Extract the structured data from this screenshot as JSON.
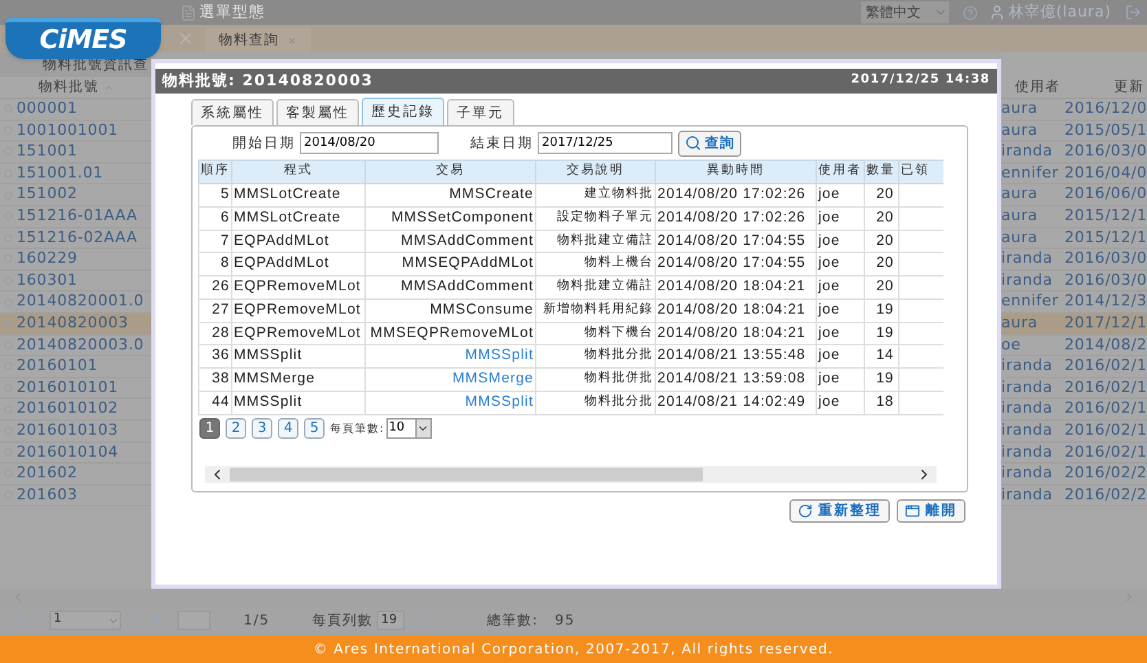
{
  "top_bar": {
    "menu_type": "選單型態",
    "language": "繁體中文",
    "user": "林宰億(laura)"
  },
  "logo": "CiMES",
  "tabs": [
    {
      "label": "物料查詢",
      "selected": true
    }
  ],
  "list_panel": {
    "title": "物料批號資訊查",
    "column": "物料批號",
    "columns_right": [
      "使用者",
      "更新"
    ],
    "rows": [
      {
        "lot": "000001",
        "user": "aura",
        "updated": "2016/12/0",
        "selected": false
      },
      {
        "lot": "1001001001",
        "user": "aura",
        "updated": "2015/05/1",
        "selected": false
      },
      {
        "lot": "151001",
        "user": "iranda",
        "updated": "2016/03/0",
        "selected": false
      },
      {
        "lot": "151001.01",
        "user": "ennifer",
        "updated": "2016/04/0",
        "selected": false
      },
      {
        "lot": "151002",
        "user": "aura",
        "updated": "2016/06/0",
        "selected": false
      },
      {
        "lot": "151216-01AAA",
        "user": "aura",
        "updated": "2015/12/1",
        "selected": false
      },
      {
        "lot": "151216-02AAA",
        "user": "aura",
        "updated": "2015/12/1",
        "selected": false
      },
      {
        "lot": "160229",
        "user": "iranda",
        "updated": "2016/03/0",
        "selected": false
      },
      {
        "lot": "160301",
        "user": "iranda",
        "updated": "2016/03/0",
        "selected": false
      },
      {
        "lot": "20140820001.0",
        "user": "ennifer",
        "updated": "2014/12/3",
        "selected": false
      },
      {
        "lot": "20140820003",
        "user": "aura",
        "updated": "2017/12/1",
        "selected": true
      },
      {
        "lot": "20140820003.0",
        "user": "oe",
        "updated": "2014/08/2",
        "selected": false
      },
      {
        "lot": "20160101",
        "user": "iranda",
        "updated": "2016/02/1",
        "selected": false
      },
      {
        "lot": "2016010101",
        "user": "iranda",
        "updated": "2016/02/1",
        "selected": false
      },
      {
        "lot": "2016010102",
        "user": "iranda",
        "updated": "2016/02/1",
        "selected": false
      },
      {
        "lot": "2016010103",
        "user": "iranda",
        "updated": "2016/02/1",
        "selected": false
      },
      {
        "lot": "2016010104",
        "user": "iranda",
        "updated": "2016/02/1",
        "selected": false
      },
      {
        "lot": "201602",
        "user": "iranda",
        "updated": "2016/02/2",
        "selected": false
      },
      {
        "lot": "201603",
        "user": "iranda",
        "updated": "2016/02/2",
        "selected": false
      }
    ]
  },
  "pager": {
    "page": "1",
    "page_count": "1/5",
    "rows_per_page_label": "每頁列數",
    "rows_per_page": "19",
    "total_label": "總筆數:",
    "total": "95"
  },
  "footer": "© Ares International Corporation, 2007-2017, All rights reserved.",
  "dialog": {
    "title": "物料批號: 20140820003",
    "time": "2017/12/25 14:38",
    "tabs": [
      {
        "label": "系統屬性",
        "selected": false
      },
      {
        "label": "客製屬性",
        "selected": false
      },
      {
        "label": "歷史記錄",
        "selected": true
      },
      {
        "label": "子單元",
        "selected": false
      }
    ],
    "start_label": "開始日期",
    "start_date": "2014/08/20",
    "end_label": "結束日期",
    "end_date": "2017/12/25",
    "query_button": "查詢",
    "columns": [
      "順序",
      "程式",
      "交易",
      "交易說明",
      "異動時間",
      "使用者",
      "數量",
      "已領"
    ],
    "rows": [
      {
        "seq": "5",
        "program": "MMSLotCreate",
        "transaction": "MMSCreate",
        "link": false,
        "description": "建立物料批",
        "time": "2014/08/20 17:02:26",
        "user": "joe",
        "qty": "20"
      },
      {
        "seq": "6",
        "program": "MMSLotCreate",
        "transaction": "MMSSetComponent",
        "link": false,
        "description": "設定物料子單元",
        "time": "2014/08/20 17:02:26",
        "user": "joe",
        "qty": "20"
      },
      {
        "seq": "7",
        "program": "EQPAddMLot",
        "transaction": "MMSAddComment",
        "link": false,
        "description": "物料批建立備註",
        "time": "2014/08/20 17:04:55",
        "user": "joe",
        "qty": "20"
      },
      {
        "seq": "8",
        "program": "EQPAddMLot",
        "transaction": "MMSEQPAddMLot",
        "link": false,
        "description": "物料上機台",
        "time": "2014/08/20 17:04:55",
        "user": "joe",
        "qty": "20"
      },
      {
        "seq": "26",
        "program": "EQPRemoveMLot",
        "transaction": "MMSAddComment",
        "link": false,
        "description": "物料批建立備註",
        "time": "2014/08/20 18:04:21",
        "user": "joe",
        "qty": "20"
      },
      {
        "seq": "27",
        "program": "EQPRemoveMLot",
        "transaction": "MMSConsume",
        "link": false,
        "description": "新增物料耗用紀錄",
        "time": "2014/08/20 18:04:21",
        "user": "joe",
        "qty": "19"
      },
      {
        "seq": "28",
        "program": "EQPRemoveMLot",
        "transaction": "MMSEQPRemoveMLot",
        "link": false,
        "description": "物料下機台",
        "time": "2014/08/20 18:04:21",
        "user": "joe",
        "qty": "19"
      },
      {
        "seq": "36",
        "program": "MMSSplit",
        "transaction": "MMSSplit",
        "link": true,
        "description": "物料批分批",
        "time": "2014/08/21 13:55:48",
        "user": "joe",
        "qty": "14"
      },
      {
        "seq": "38",
        "program": "MMSMerge",
        "transaction": "MMSMerge",
        "link": true,
        "description": "物料批併批",
        "time": "2014/08/21 13:59:08",
        "user": "joe",
        "qty": "19"
      },
      {
        "seq": "44",
        "program": "MMSSplit",
        "transaction": "MMSSplit",
        "link": true,
        "description": "物料批分批",
        "time": "2014/08/21 14:02:49",
        "user": "joe",
        "qty": "18"
      }
    ],
    "pages": [
      {
        "label": "1",
        "selected": true
      },
      {
        "label": "2",
        "selected": false
      },
      {
        "label": "3",
        "selected": false
      },
      {
        "label": "4",
        "selected": false
      },
      {
        "label": "5",
        "selected": false
      }
    ],
    "page_size_label": "每頁筆數:",
    "page_size": "10",
    "buttons": [
      {
        "kind": "refresh",
        "label": "重新整理"
      },
      {
        "kind": "exit",
        "label": "離開"
      }
    ]
  }
}
